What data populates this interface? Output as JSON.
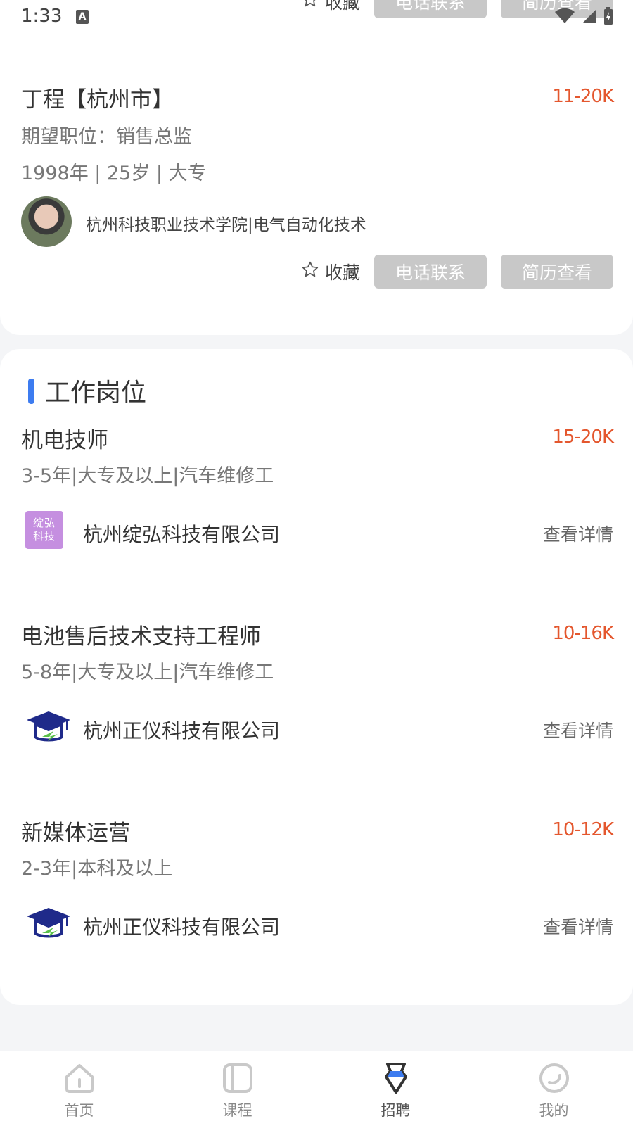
{
  "status_bar": {
    "time": "1:33",
    "a_icon": "A"
  },
  "top_card": {
    "ghost_fav": "收藏",
    "ghost_call": "电话联系",
    "ghost_resume": "简历查看",
    "candidate": {
      "name": "丁程【杭州市】",
      "salary": "11-20K",
      "expect": "期望职位：销售总监",
      "meta": "1998年 | 25岁 | 大专",
      "school": "杭州科技职业技术学院|电气自动化技术"
    },
    "actions": {
      "fav": "收藏",
      "call": "电话联系",
      "resume": "简历查看"
    }
  },
  "jobs_section": {
    "title": "工作岗位",
    "jobs": [
      {
        "title": "机电技师",
        "salary": "15-20K",
        "requirements": "3-5年|大专及以上|汽车维修工",
        "company": "杭州绽弘科技有限公司",
        "logo_text": "绽弘科技",
        "detail": "查看详情"
      },
      {
        "title": "电池售后技术支持工程师",
        "salary": "10-16K",
        "requirements": "5-8年|大专及以上|汽车维修工",
        "company": "杭州正仪科技有限公司",
        "detail": "查看详情"
      },
      {
        "title": "新媒体运营",
        "salary": "10-12K",
        "requirements": "2-3年|本科及以上",
        "company": "杭州正仪科技有限公司",
        "detail": "查看详情"
      }
    ]
  },
  "tabbar": {
    "tabs": [
      {
        "label": "首页",
        "icon": "home-icon"
      },
      {
        "label": "课程",
        "icon": "course-icon"
      },
      {
        "label": "招聘",
        "icon": "recruit-icon",
        "active": true
      },
      {
        "label": "我的",
        "icon": "profile-icon"
      }
    ]
  },
  "colors": {
    "accent_blue": "#3d7cf0",
    "salary_orange": "#e4572e",
    "button_gray": "#c8c8c8",
    "logo_purple": "#c58fe0"
  }
}
